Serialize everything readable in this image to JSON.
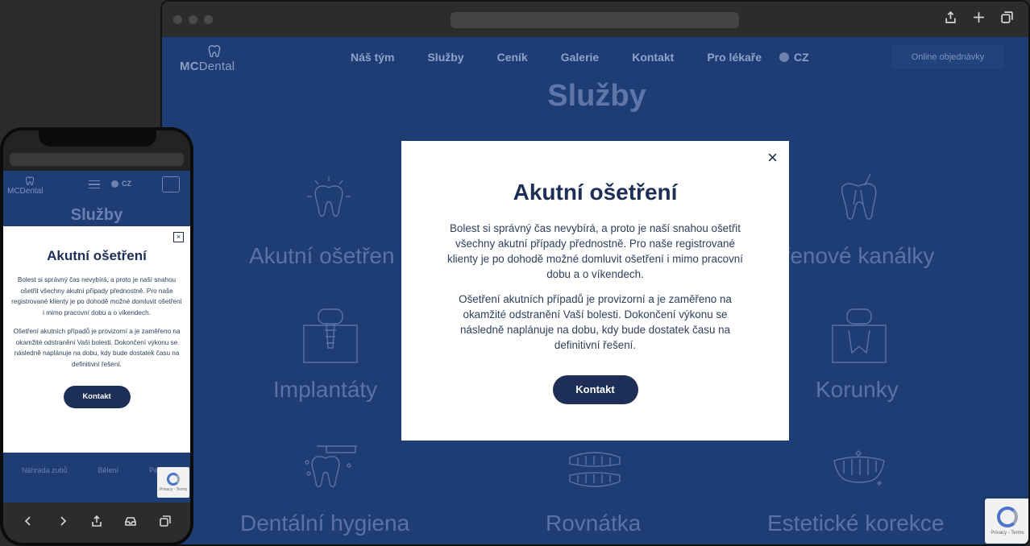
{
  "site": {
    "logo_mc": "MC",
    "logo_dental": "Dental",
    "nav": [
      "Náš tým",
      "Služby",
      "Ceník",
      "Galerie",
      "Kontakt",
      "Pro lékaře"
    ],
    "language": "CZ",
    "online_booking": "Online objednávky",
    "page_title": "Služby"
  },
  "services": {
    "acute": "Akutní ošetřen",
    "canals": "řenové kanálky",
    "implants": "Implantáty",
    "crowns": "Korunky",
    "hygiene": "Dentální hygiena",
    "braces": "Rovnátka",
    "aesthetic": "Estetické korekce"
  },
  "modal": {
    "close": "×",
    "title": "Akutní ošetření",
    "p1": "Bolest si správný čas nevybírá, a proto je naší snahou ošetřit všechny akutní případy přednostně. Pro naše registrované klienty je po dohodě možné domluvit ošetření i mimo pracovní dobu a o víkendech.",
    "p2": "Ošetření akutních případů je provizorní a je zaměřeno na okamžité odstranění Vaší bolesti. Dokončení výkonu se následně naplánuje na dobu, kdy bude dostatek času na definitivní řešení.",
    "button": "Kontakt"
  },
  "mobile": {
    "logo": "MCDental",
    "language": "CZ",
    "page_title": "Služby",
    "services": [
      "Náhrada zubů",
      "Bělení",
      "Péče o"
    ]
  },
  "recaptcha": {
    "label": "Privacy - Terms"
  },
  "colors": {
    "page_bg": "#1e3d74",
    "modal_bg": "#ffffff",
    "primary_button": "#1d2f56",
    "title_text": "#1d2f56"
  }
}
